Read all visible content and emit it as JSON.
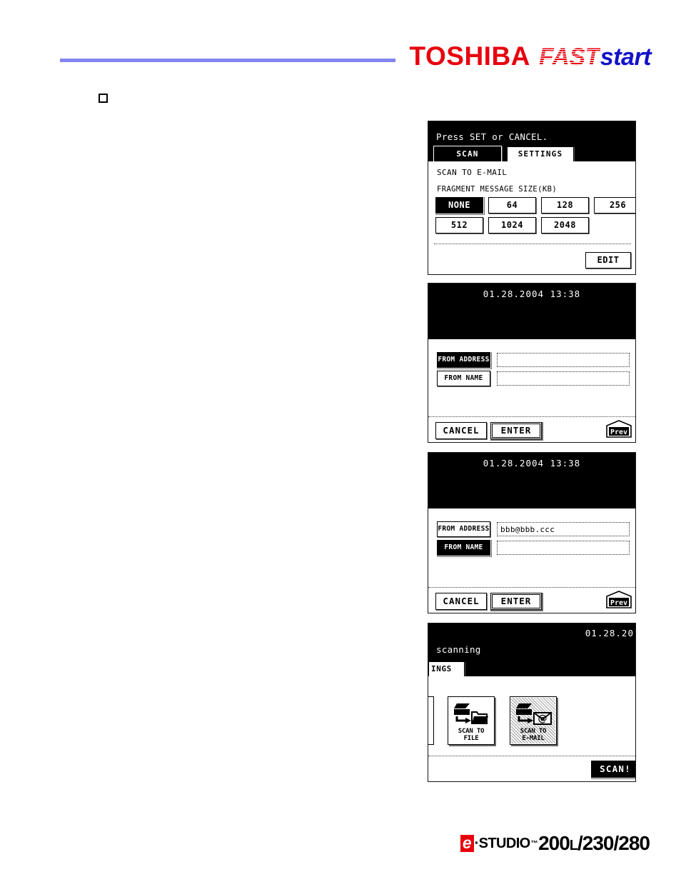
{
  "header": {
    "brand_toshiba": "TOSHIBA",
    "brand_fast": "FAST",
    "brand_start": "start"
  },
  "footer": {
    "e_mark": "e",
    "studio": "·STUDIO",
    "tm": "™",
    "model": "200",
    "model_sub": "L",
    "model_rest": "/230/280"
  },
  "panels": [
    {
      "name": "scan-settings-fragment-size",
      "message": "Press SET or CANCEL.",
      "tabs": [
        {
          "label": "SCAN",
          "selected": true
        },
        {
          "label": "SETTINGS",
          "selected": false
        }
      ],
      "sub_title": "SCAN TO E-MAIL",
      "field_label": "FRAGMENT MESSAGE SIZE(KB)",
      "size_options_row1": [
        {
          "label": "NONE",
          "selected": true
        },
        {
          "label": "64",
          "selected": false
        },
        {
          "label": "128",
          "selected": false
        },
        {
          "label": "256",
          "selected": false
        }
      ],
      "size_options_row2": [
        {
          "label": "512",
          "selected": false
        },
        {
          "label": "1024",
          "selected": false
        },
        {
          "label": "2048",
          "selected": false
        }
      ],
      "edit_label": "EDIT"
    },
    {
      "name": "from-address-entry-empty",
      "clock": "01.28.2004 13:38",
      "rows": [
        {
          "key": "FROM ADDRESS",
          "selected": true,
          "value": ""
        },
        {
          "key": "FROM NAME",
          "selected": false,
          "value": ""
        }
      ],
      "cancel_label": "CANCEL",
      "enter_label": "ENTER",
      "prev_label": "Prev"
    },
    {
      "name": "from-address-entry-filled",
      "clock": "01.28.2004 13:38",
      "rows": [
        {
          "key": "FROM ADDRESS",
          "selected": false,
          "value": "bbb@bbb.ccc"
        },
        {
          "key": "FROM NAME",
          "selected": true,
          "value": ""
        }
      ],
      "cancel_label": "CANCEL",
      "enter_label": "ENTER",
      "prev_label": "Prev"
    },
    {
      "name": "scanning-mode-select",
      "clock": "01.28.20",
      "status": "scanning",
      "tab_clipped": "INGS",
      "tiles": [
        {
          "label_line1": "SCAN TO",
          "label_line2": "FILE",
          "icon": "scan-to-file-icon",
          "selected": false
        },
        {
          "label_line1": "SCAN TO",
          "label_line2": "E-MAIL",
          "icon": "scan-to-email-icon",
          "selected": true
        }
      ],
      "scan_label": "SCAN!"
    }
  ]
}
